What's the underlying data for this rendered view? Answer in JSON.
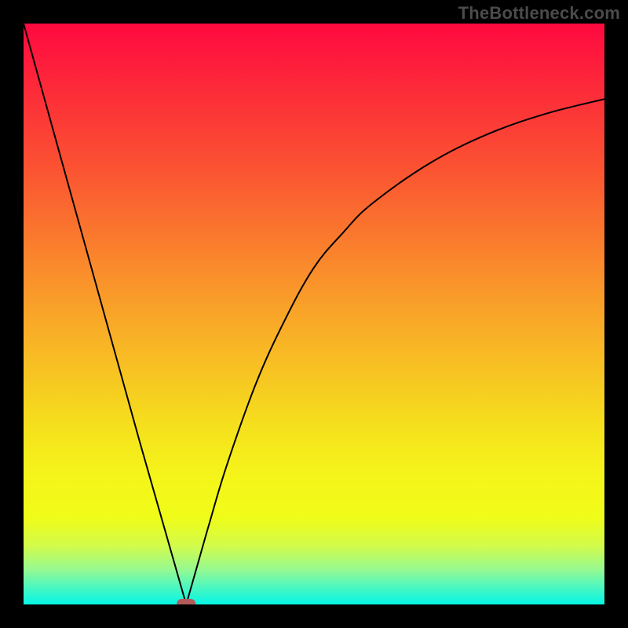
{
  "watermark": "TheBottleneck.com",
  "chart_data": {
    "type": "line",
    "title": "",
    "xlabel": "",
    "ylabel": "",
    "xlim": [
      0,
      100
    ],
    "ylim": [
      0,
      100
    ],
    "grid": false,
    "legend": false,
    "series": [
      {
        "name": "left-branch",
        "x": [
          0,
          5,
          10,
          15,
          20,
          24,
          26,
          27,
          28
        ],
        "y": [
          100,
          82,
          64,
          46,
          28,
          14,
          7,
          3.5,
          0
        ]
      },
      {
        "name": "right-branch",
        "x": [
          28,
          29,
          30,
          32,
          35,
          40,
          45,
          50,
          55,
          60,
          70,
          80,
          90,
          100
        ],
        "y": [
          0,
          3.5,
          7,
          14,
          24,
          38,
          49,
          58,
          64,
          69,
          76,
          81,
          84.5,
          87
        ]
      }
    ],
    "marker": {
      "name": "minimum-marker",
      "x": 28,
      "y": 0,
      "color": "#b35a5a",
      "shape": "rounded-rect"
    },
    "background_gradient": {
      "type": "vertical",
      "stops": [
        {
          "offset": 0.0,
          "color": "#fe093f"
        },
        {
          "offset": 0.25,
          "color": "#fb5332"
        },
        {
          "offset": 0.5,
          "color": "#f9a528"
        },
        {
          "offset": 0.7,
          "color": "#f5e21c"
        },
        {
          "offset": 0.78,
          "color": "#f5f51a"
        },
        {
          "offset": 0.85,
          "color": "#f0fc18"
        },
        {
          "offset": 0.9,
          "color": "#d1fb4c"
        },
        {
          "offset": 0.94,
          "color": "#96f991"
        },
        {
          "offset": 0.97,
          "color": "#4cf7c0"
        },
        {
          "offset": 1.0,
          "color": "#05f6e4"
        }
      ]
    }
  }
}
